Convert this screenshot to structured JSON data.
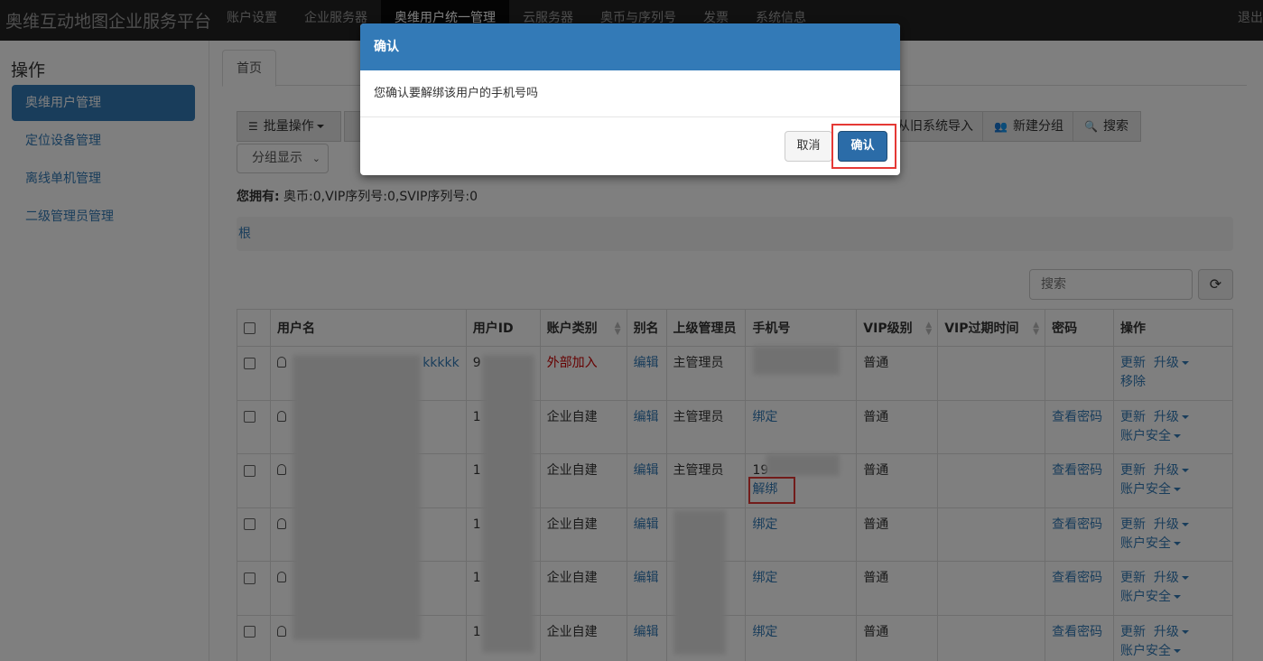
{
  "app": {
    "brand": "奥维互动地图企业服务平台",
    "nav": [
      "账户设置",
      "企业服务器",
      "奥维用户统一管理",
      "云服务器",
      "奥币与序列号",
      "发票",
      "系统信息"
    ],
    "logout": "退出"
  },
  "sidebar": {
    "title": "操作",
    "items": [
      "奥维用户管理",
      "定位设备管理",
      "离线单机管理",
      "二级管理员管理"
    ]
  },
  "tabs": {
    "home": "首页"
  },
  "toolbar": {
    "batch": "批量操作",
    "import": "从旧系统导入",
    "new_group": "新建分组",
    "search": "搜索",
    "group_display": "分组显示"
  },
  "summary": {
    "label": "您拥有:",
    "value": " 奥币:0,VIP序列号:0,SVIP序列号:0"
  },
  "breadcrumb": {
    "root": "根"
  },
  "table_search": {
    "placeholder": "搜索"
  },
  "table": {
    "headers": [
      "用户名",
      "用户ID",
      "账户类别",
      "别名",
      "上级管理员",
      "手机号",
      "VIP级别",
      "VIP过期时间",
      "密码",
      "操作"
    ],
    "rows": [
      {
        "username_suffix": "kkkkk",
        "id": "9",
        "type": "外部加入",
        "alias": "编辑",
        "admin": "主管理员",
        "phone": "",
        "phone_action": "",
        "vip": "普通",
        "pwd": "",
        "op1": "更新",
        "op2": "升级",
        "op3": "移除"
      },
      {
        "username_suffix": "",
        "id": "1",
        "type": "企业自建",
        "alias": "编辑",
        "admin": "主管理员",
        "phone": "",
        "phone_action": "绑定",
        "vip": "普通",
        "pwd": "查看密码",
        "op1": "更新",
        "op2": "升级",
        "op3": "账户安全"
      },
      {
        "username_suffix": "",
        "id": "1",
        "type": "企业自建",
        "alias": "编辑",
        "admin": "主管理员",
        "phone": "19",
        "phone_action": "解绑",
        "vip": "普通",
        "pwd": "查看密码",
        "op1": "更新",
        "op2": "升级",
        "op3": "账户安全"
      },
      {
        "username_suffix": "",
        "id": "1",
        "type": "企业自建",
        "alias": "编辑",
        "admin": "",
        "phone": "",
        "phone_action": "绑定",
        "vip": "普通",
        "pwd": "查看密码",
        "op1": "更新",
        "op2": "升级",
        "op3": "账户安全"
      },
      {
        "username_suffix": "",
        "id": "1",
        "type": "企业自建",
        "alias": "编辑",
        "admin": "",
        "phone": "",
        "phone_action": "绑定",
        "vip": "普通",
        "pwd": "查看密码",
        "op1": "更新",
        "op2": "升级",
        "op3": "账户安全"
      },
      {
        "username_suffix": "",
        "id": "1",
        "type": "企业自建",
        "alias": "编辑",
        "admin": "",
        "phone": "",
        "phone_action": "绑定",
        "vip": "普通",
        "pwd": "查看密码",
        "op1": "更新",
        "op2": "升级",
        "op3": "账户安全"
      }
    ]
  },
  "modal": {
    "title": "确认",
    "message": "您确认要解绑该用户的手机号吗",
    "cancel": "取消",
    "confirm": "确认"
  },
  "colors": {
    "primary": "#337ab7",
    "navbar": "#222222",
    "highlight": "#e53935",
    "external": "#cc0000"
  }
}
